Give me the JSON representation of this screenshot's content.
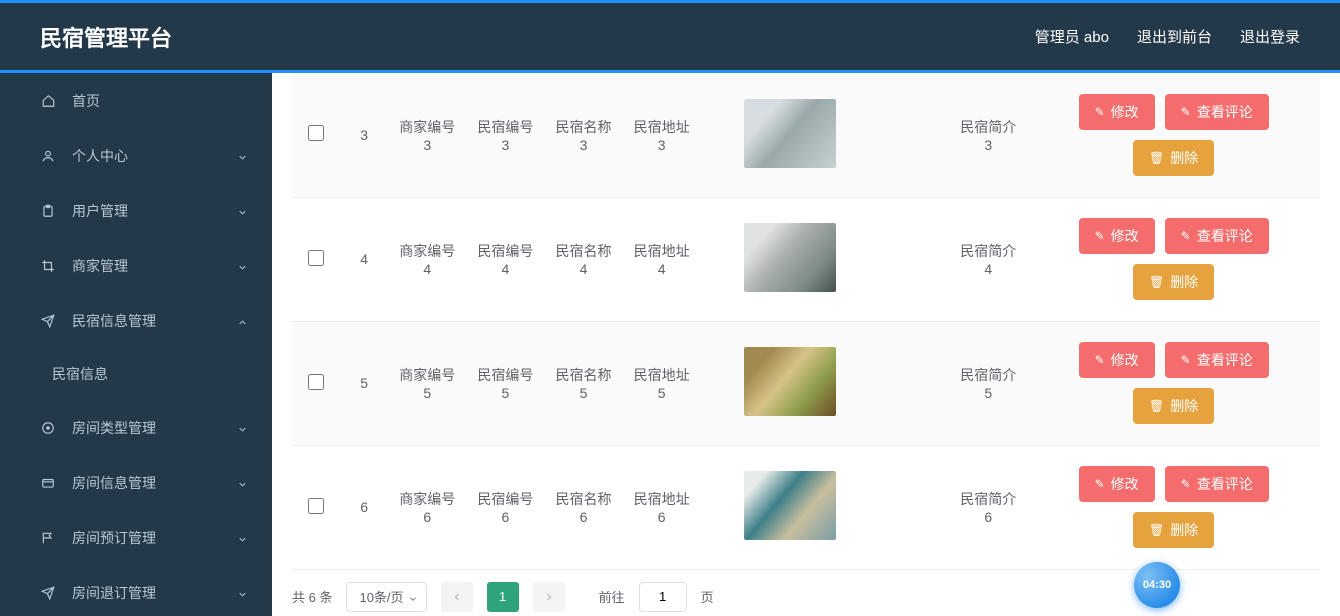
{
  "header": {
    "title": "民宿管理平台",
    "admin_label": "管理员 abo",
    "front_label": "退出到前台",
    "logout_label": "退出登录"
  },
  "sidebar": {
    "items": [
      {
        "label": "首页",
        "icon": "home",
        "expandable": false
      },
      {
        "label": "个人中心",
        "icon": "user",
        "expandable": true,
        "open": false
      },
      {
        "label": "用户管理",
        "icon": "clipboard",
        "expandable": true,
        "open": false
      },
      {
        "label": "商家管理",
        "icon": "crop",
        "expandable": true,
        "open": false
      },
      {
        "label": "民宿信息管理",
        "icon": "send",
        "expandable": true,
        "open": true,
        "children": [
          {
            "label": "民宿信息"
          }
        ]
      },
      {
        "label": "房间类型管理",
        "icon": "circle-dot",
        "expandable": true,
        "open": false
      },
      {
        "label": "房间信息管理",
        "icon": "wallet",
        "expandable": true,
        "open": false
      },
      {
        "label": "房间预订管理",
        "icon": "flag",
        "expandable": true,
        "open": false
      },
      {
        "label": "房间退订管理",
        "icon": "send",
        "expandable": true,
        "open": false
      }
    ]
  },
  "table": {
    "rows": [
      {
        "idx": "3",
        "c1": "商家编号3",
        "c2": "民宿编号3",
        "c3": "民宿名称3",
        "c4": "民宿地址3",
        "c5": "民宿简介3",
        "thumb": "r3"
      },
      {
        "idx": "4",
        "c1": "商家编号4",
        "c2": "民宿编号4",
        "c3": "民宿名称4",
        "c4": "民宿地址4",
        "c5": "民宿简介4",
        "thumb": "r4"
      },
      {
        "idx": "5",
        "c1": "商家编号5",
        "c2": "民宿编号5",
        "c3": "民宿名称5",
        "c4": "民宿地址5",
        "c5": "民宿简介5",
        "thumb": "r5"
      },
      {
        "idx": "6",
        "c1": "商家编号6",
        "c2": "民宿编号6",
        "c3": "民宿名称6",
        "c4": "民宿地址6",
        "c5": "民宿简介6",
        "thumb": "r6"
      }
    ]
  },
  "actions": {
    "edit": "修改",
    "comments": "查看评论",
    "delete": "删除"
  },
  "pager": {
    "total_text": "共 6 条",
    "per_page": "10条/页",
    "current": "1",
    "goto_prefix": "前往",
    "goto_value": "1",
    "goto_suffix": "页"
  },
  "timer": "04:30"
}
